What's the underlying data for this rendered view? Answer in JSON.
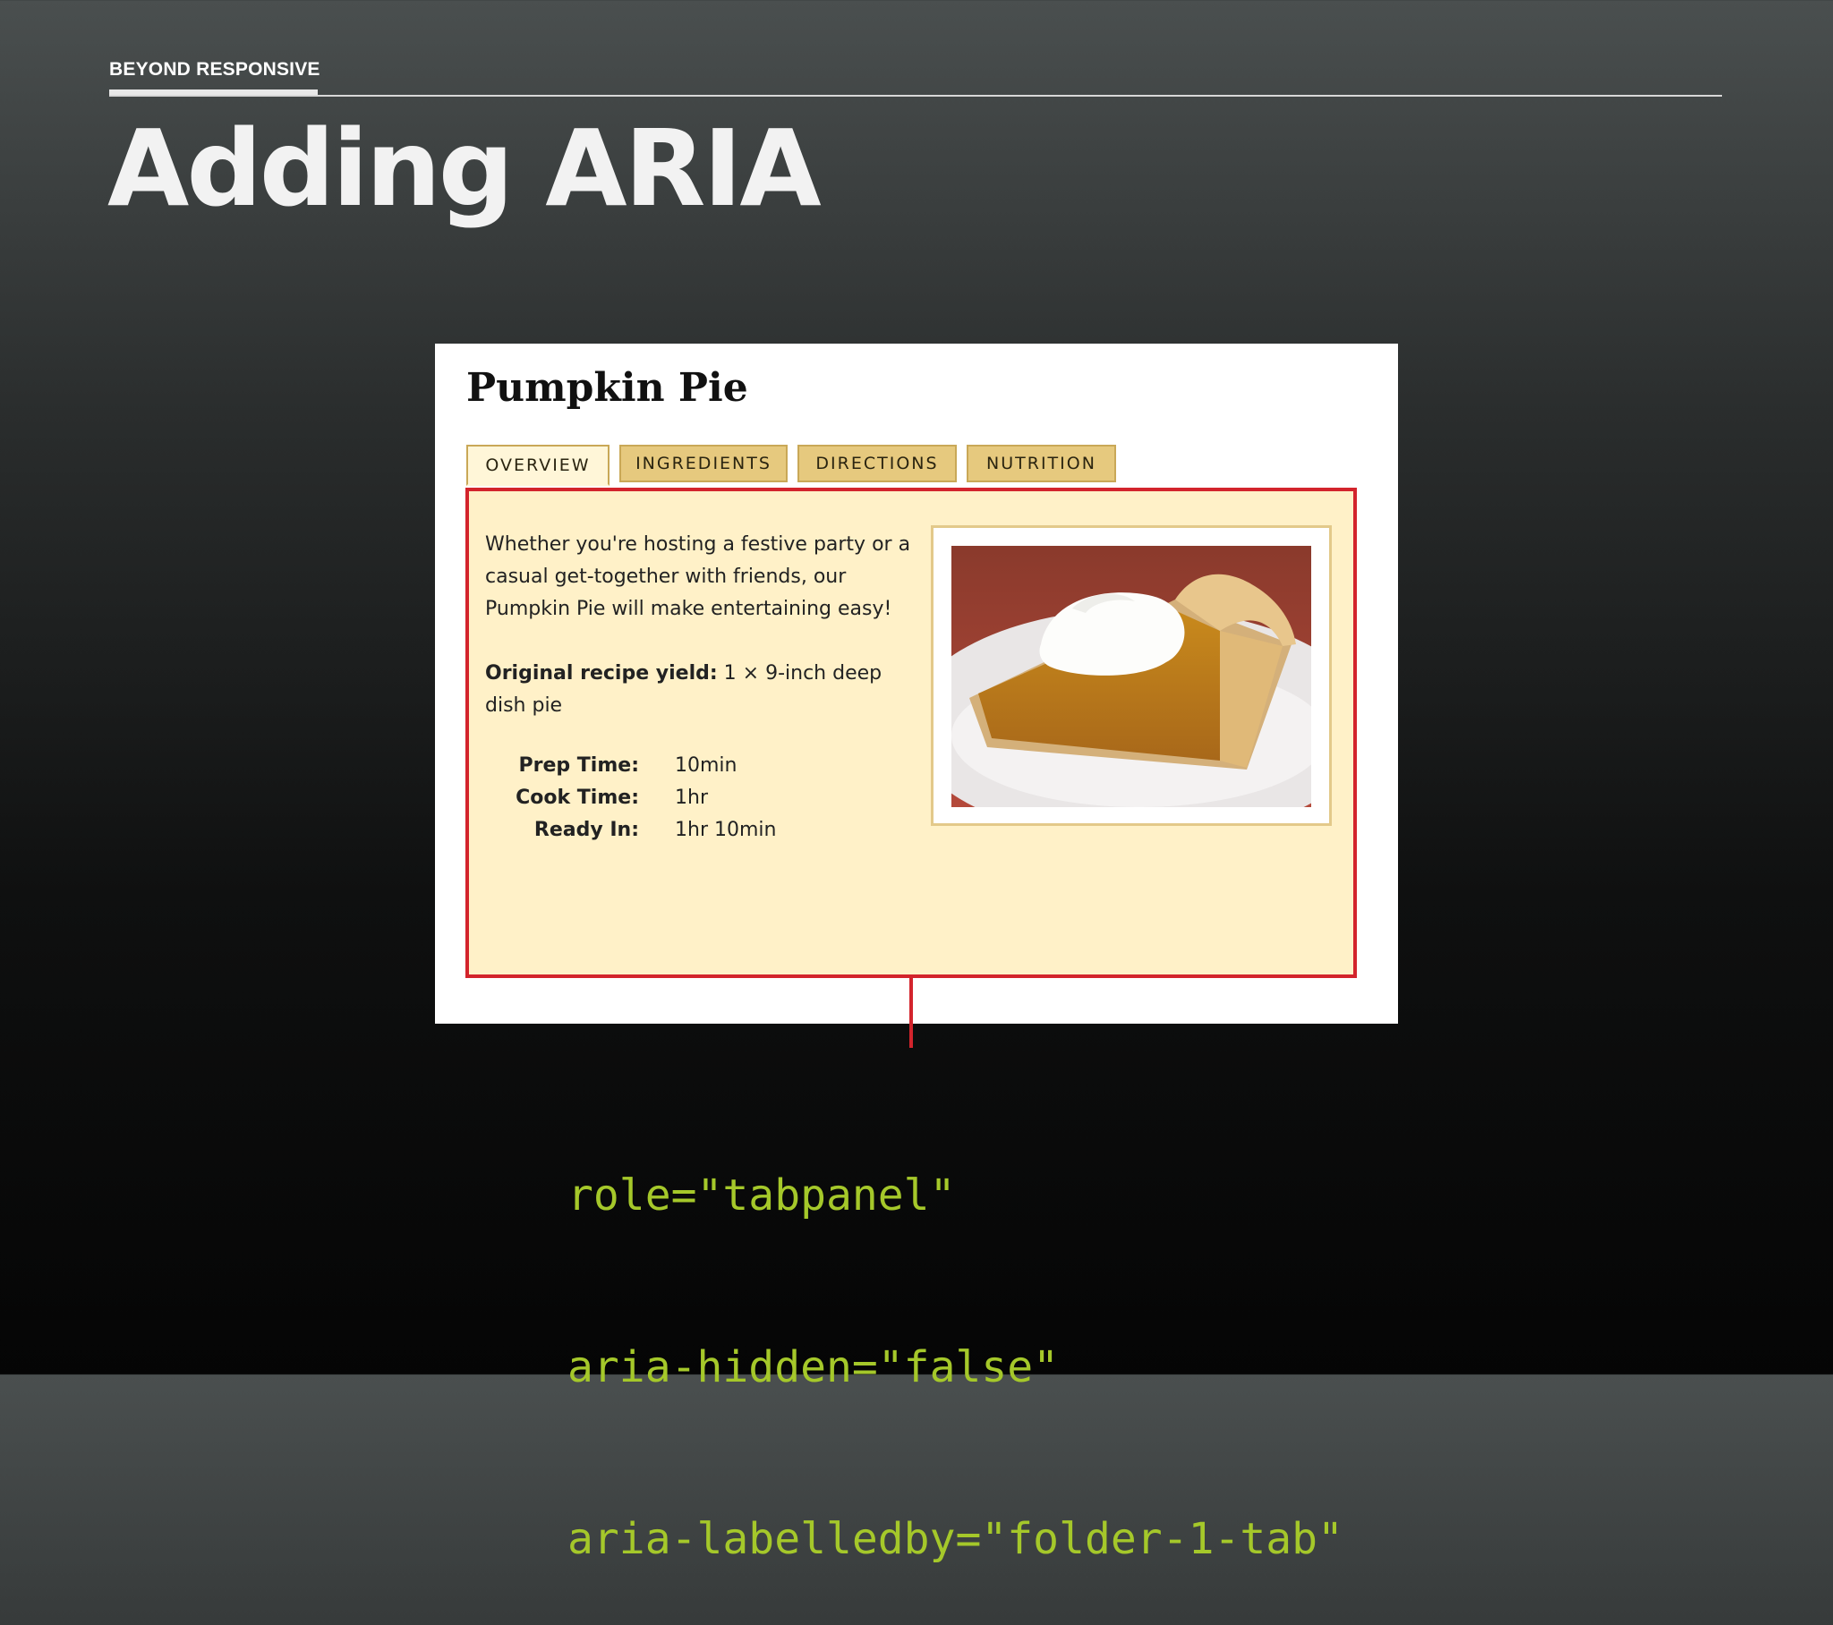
{
  "section": {
    "label": "BEYOND RESPONSIVE"
  },
  "slide": {
    "title": "Adding ARIA"
  },
  "screenshot": {
    "recipe_title": "Pumpkin Pie",
    "tabs": [
      {
        "label": "OVERVIEW",
        "active": true
      },
      {
        "label": "INGREDIENTS",
        "active": false
      },
      {
        "label": "DIRECTIONS",
        "active": false
      },
      {
        "label": "NUTRITION",
        "active": false
      }
    ],
    "panel": {
      "intro": "Whether you're hosting a festive party or a casual get-together with friends, our Pumpkin Pie will make entertaining easy!",
      "yield_label": "Original recipe yield:",
      "yield_value": " 1 × 9-inch deep dish pie",
      "times": [
        {
          "label": "Prep Time:",
          "value": "10min"
        },
        {
          "label": "Cook Time:",
          "value": "1hr"
        },
        {
          "label": "Ready In:",
          "value": "1hr 10min"
        }
      ],
      "photo_icon": "pumpkin-pie-photo"
    }
  },
  "annotation": {
    "line1": "role=\"tabpanel\"",
    "line2": "aria-hidden=\"false\"",
    "line3": "aria-labelledby=\"folder-1-tab\"",
    "color": "#a5c82a",
    "highlight_color": "#d3242c"
  }
}
